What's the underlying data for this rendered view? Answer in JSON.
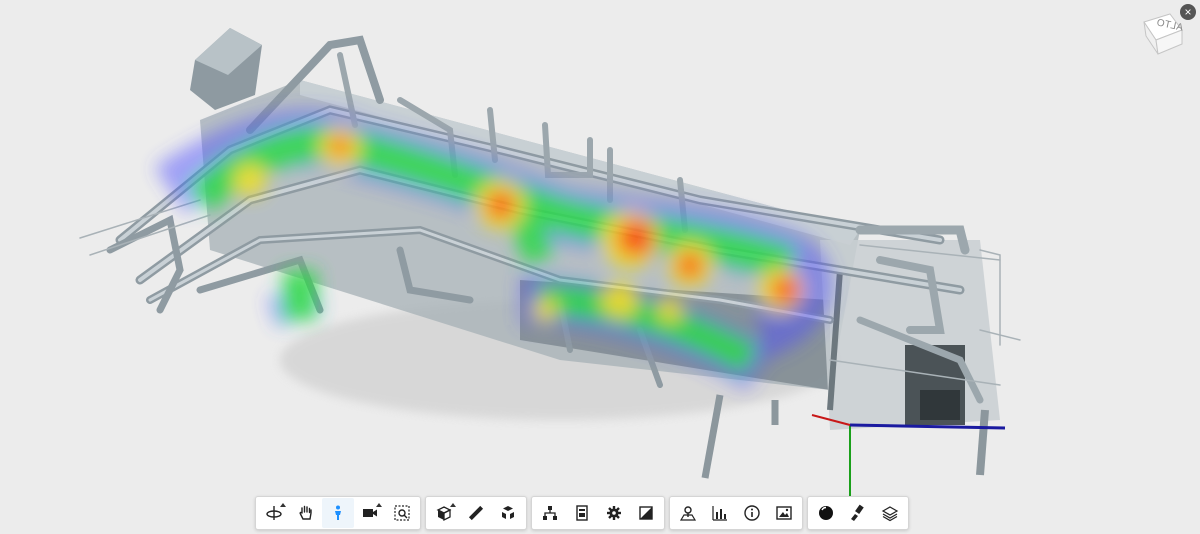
{
  "viewer": {
    "viewcube_label": "ALTO",
    "accent": "#1e90ff",
    "heat_colors": [
      "#3a3aff",
      "#27d84a",
      "#f0e020",
      "#ff7a10",
      "#ff2a10"
    ]
  },
  "toolbar": {
    "groups": [
      {
        "tools": [
          "orbit-tool",
          "pan-tool",
          "first-person-tool",
          "camera-tool",
          "fit-to-view-tool"
        ]
      },
      {
        "tools": [
          "section-tool",
          "measure-tool",
          "explode-tool"
        ]
      },
      {
        "tools": [
          "model-browser-tool",
          "properties-tool",
          "settings-tool",
          "fullscreen-tool"
        ]
      },
      {
        "tools": [
          "map-pin-tool",
          "charts-tool",
          "info-tool",
          "image-tool"
        ]
      },
      {
        "tools": [
          "render-mode-tool",
          "paint-tool",
          "layers-tool"
        ]
      }
    ],
    "active_tool": "first-person-tool"
  }
}
